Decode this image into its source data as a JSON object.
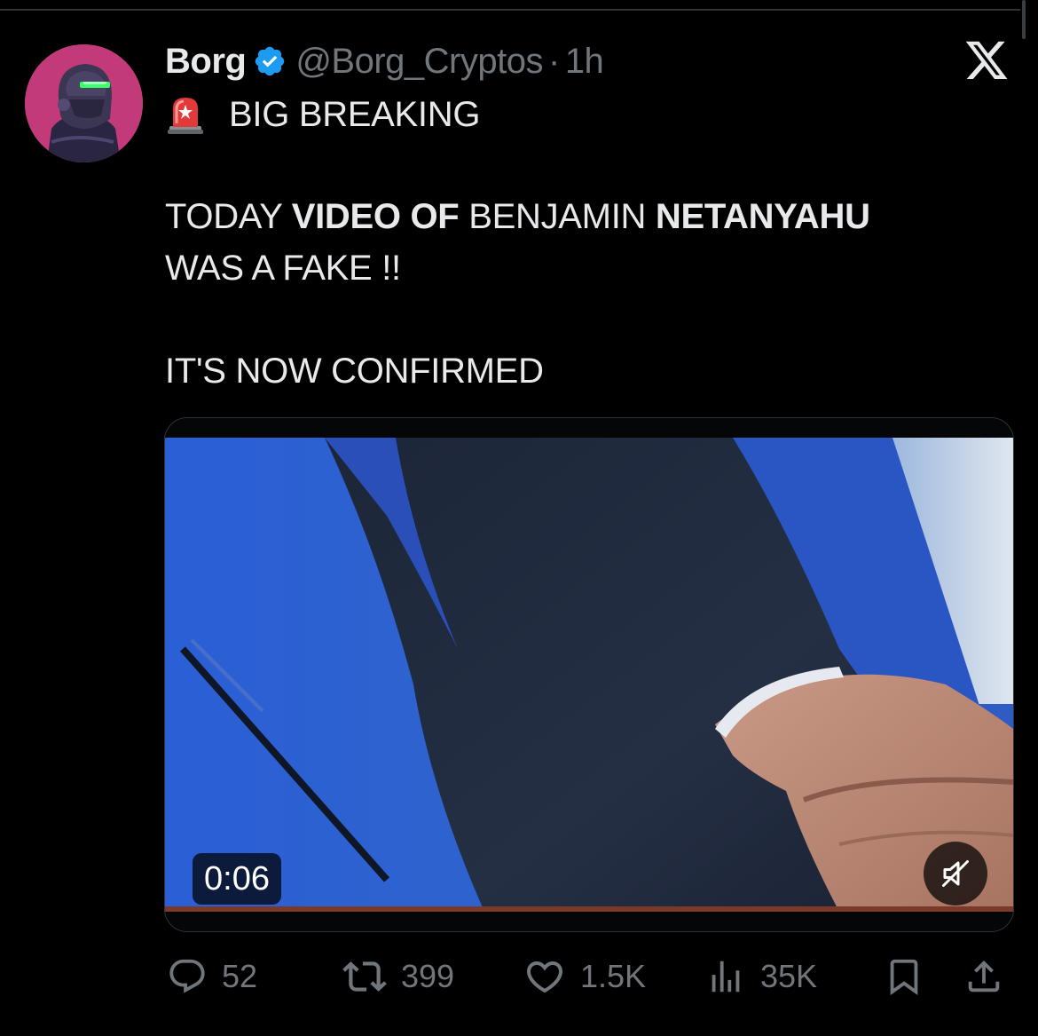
{
  "tweet": {
    "author": {
      "display_name": "Borg",
      "handle": "@Borg_Cryptos",
      "verified": true
    },
    "separator": "·",
    "timestamp": "1h",
    "platform_logo": "x-logo-icon",
    "text": {
      "line1": "BIG BREAKING",
      "line2_a": "TODAY ",
      "line2_b": "VIDEO OF",
      "line2_c": " BENJAMIN ",
      "line2_d": "NETANYAHU",
      "line3": "WAS A FAKE !!",
      "line4": "IT'S NOW CONFIRMED"
    },
    "media": {
      "duration": "0:06",
      "muted": true
    },
    "stats": {
      "replies": "52",
      "reposts": "399",
      "likes": "1.5K",
      "views": "35K"
    }
  },
  "colors": {
    "background": "#000000",
    "text_primary": "#e7e9ea",
    "text_secondary": "#71767b",
    "verified_blue": "#1d9bf0",
    "avatar_bg": "#c23a7a"
  },
  "icons": [
    "siren-icon",
    "verified-icon",
    "reply-icon",
    "repost-icon",
    "like-icon",
    "views-icon",
    "bookmark-icon",
    "share-icon",
    "mute-icon"
  ]
}
